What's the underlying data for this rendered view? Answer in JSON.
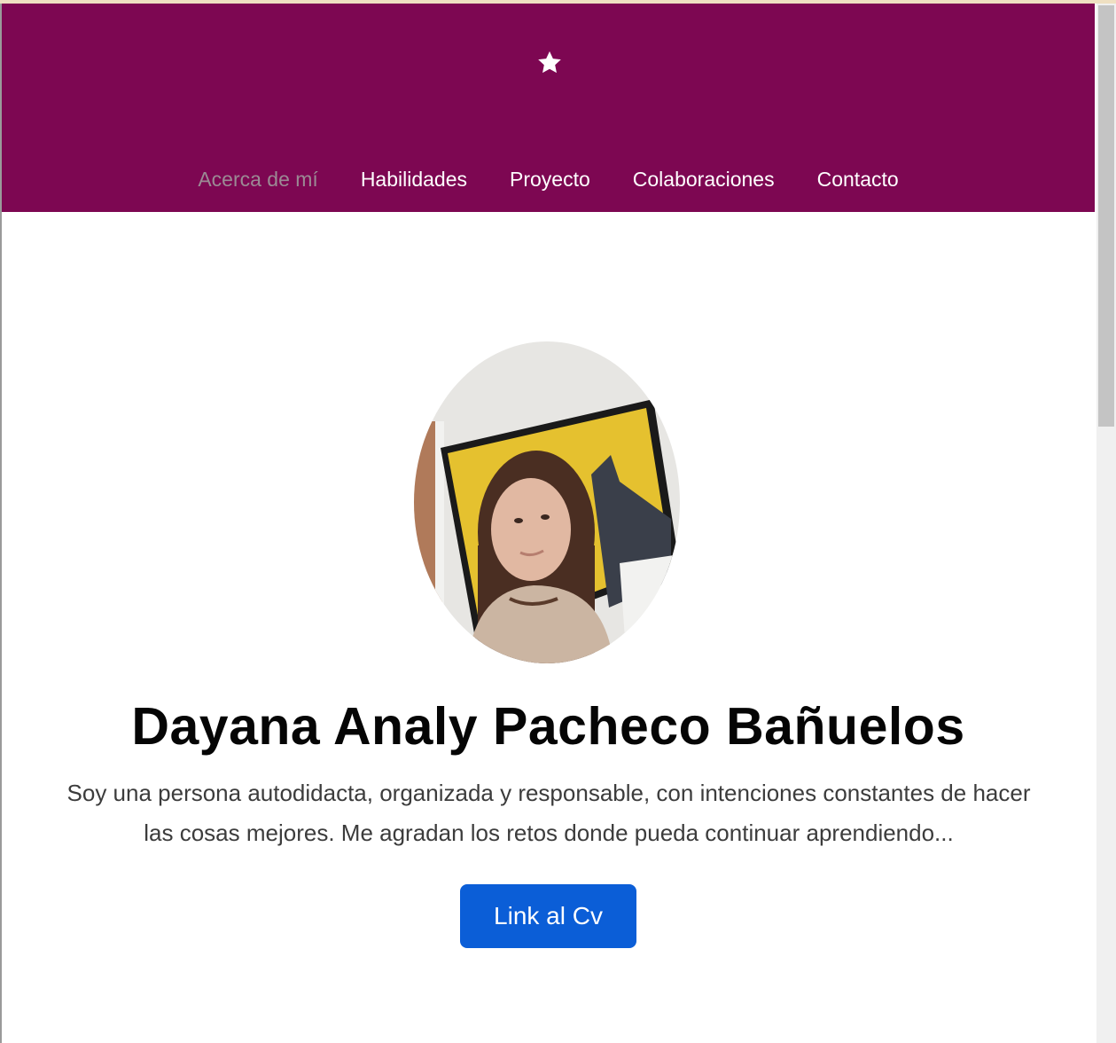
{
  "header": {
    "logo_icon": "star-icon",
    "background_color": "#7d0752"
  },
  "nav": {
    "items": [
      {
        "label": "Acerca de mí",
        "active": true
      },
      {
        "label": "Habilidades",
        "active": false
      },
      {
        "label": "Proyecto",
        "active": false
      },
      {
        "label": "Colaboraciones",
        "active": false
      },
      {
        "label": "Contacto",
        "active": false
      }
    ]
  },
  "profile": {
    "name": "Dayana Analy Pacheco Bañuelos",
    "bio": "Soy una persona autodidacta, organizada y responsable, con intenciones constantes de hacer las cosas mejores. Me agradan los retos donde pueda continuar aprendiendo...",
    "cv_button_label": "Link al Cv",
    "cv_button_color": "#0b5ed7"
  }
}
